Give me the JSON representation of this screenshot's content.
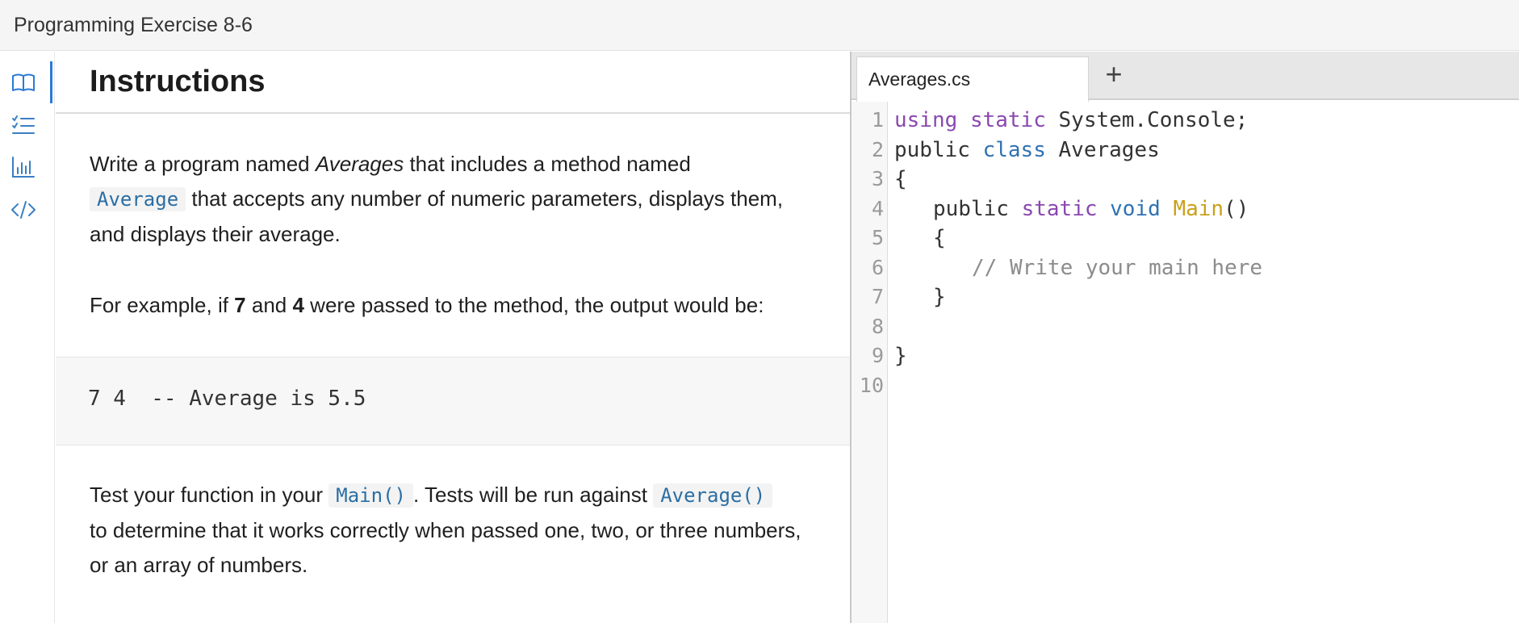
{
  "window": {
    "title": "Programming Exercise 8-6"
  },
  "sidebar": {
    "icons": [
      "book-icon",
      "checklist-icon",
      "bar-chart-icon",
      "code-icon"
    ]
  },
  "instructions": {
    "heading": "Instructions",
    "p1": {
      "pre": "Write a program named ",
      "em": "Averages",
      "mid": " that includes a method named",
      "code": "Average",
      "post": " that accepts any number of numeric parameters, displays them, and displays their average."
    },
    "p2": {
      "pre": "For example, if ",
      "b1": "7",
      "mid": " and ",
      "b2": "4",
      "post": " were passed to the method, the output would be:"
    },
    "sample_output": "7 4  -- Average is 5.5",
    "p3": {
      "pre": "Test your function in your ",
      "code1": "Main()",
      "mid": ". Tests will be run against ",
      "code2": "Average()",
      "post": "to determine that it works correctly when passed one, two, or three numbers, or an array of numbers."
    }
  },
  "editor": {
    "tab_label": "Averages.cs",
    "add_tab_label": "+",
    "line_numbers": [
      "1",
      "2",
      "3",
      "4",
      "5",
      "6",
      "7",
      "8",
      "9",
      "10"
    ],
    "code": {
      "l1_kw1": "using",
      "l1_kw2": "static",
      "l1_rest": " System.Console;",
      "l2_kw": "public",
      "l2_cls": "class",
      "l2_rest": " Averages",
      "l3": "{",
      "l4_pub": "public ",
      "l4_kw1": "static",
      "l4_kw2": "void",
      "l4_fn": "Main",
      "l4_rest": "()",
      "l5": "{",
      "l6": "// Write your main here",
      "l7": "}",
      "l9": "}"
    }
  },
  "colors": {
    "keyword": "#8a48b0",
    "type": "#2f72b5",
    "function": "#c9a01c",
    "comment": "#8c8c8c",
    "active_indicator": "#2a7bd6"
  }
}
